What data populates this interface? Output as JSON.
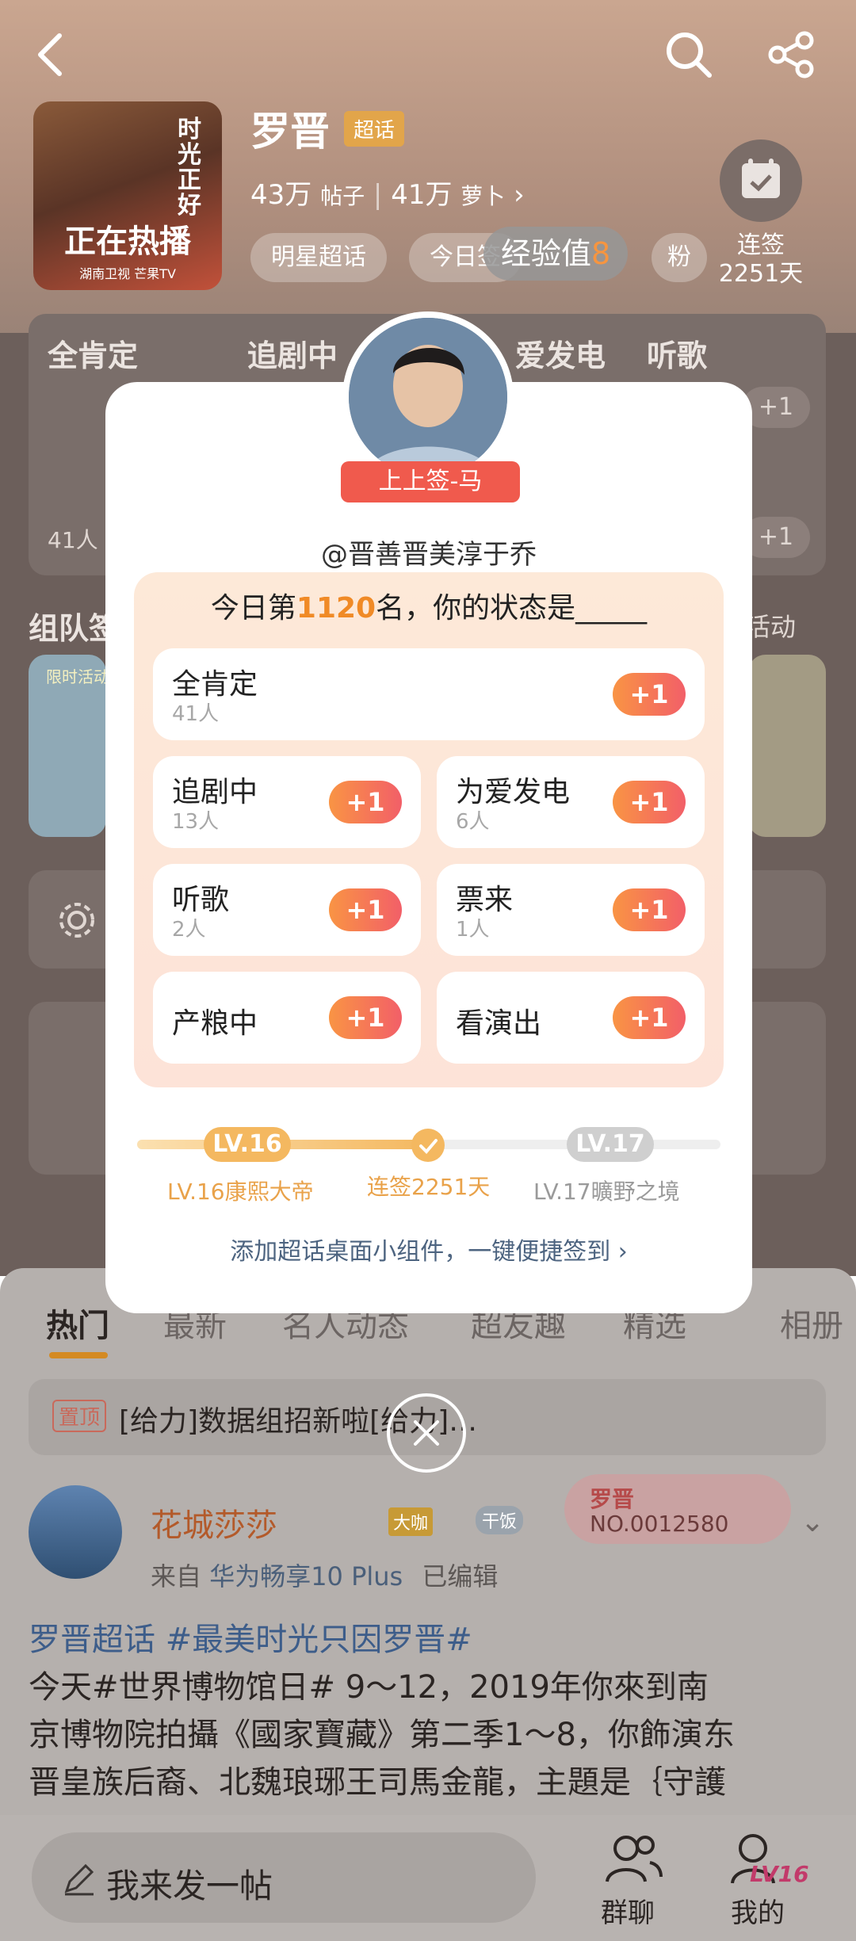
{
  "header": {
    "title": "罗晋",
    "badge": "超话",
    "posts_count": "43万",
    "posts_label": "帖子",
    "fans_count": "41万",
    "fans_label": "萝卜",
    "tag_star": "明星超话",
    "tag_today": "今日签",
    "tag_fans": "粉",
    "exp_toast": "经验值",
    "exp_toast_num": "8",
    "sign_label": "连签",
    "sign_days": "2251天",
    "cover_main": "正在热播",
    "cover_side": "时光正好",
    "cover_sub": "湖南卫视 芒果TV"
  },
  "background": {
    "cat_1": "全肯定",
    "cat_2": "追剧中",
    "cat_3": "爱发电",
    "cat_4": "听歌",
    "plus": "+1",
    "people": "41人",
    "team_label": "组队签",
    "activity_label": "活动",
    "limited": "限时活动"
  },
  "dialog": {
    "ribbon": "上上签-马",
    "username": "@晋善晋美淳于乔",
    "rank_prefix": "今日第",
    "rank_number": "1120",
    "rank_suffix": "名，你的状态是_____",
    "options": [
      {
        "name": "全肯定",
        "count": "41人",
        "plus": "+1"
      },
      {
        "name": "追剧中",
        "count": "13人",
        "plus": "+1"
      },
      {
        "name": "为爱发电",
        "count": "6人",
        "plus": "+1"
      },
      {
        "name": "听歌",
        "count": "2人",
        "plus": "+1"
      },
      {
        "name": "票来",
        "count": "1人",
        "plus": "+1"
      },
      {
        "name": "产粮中",
        "count": "",
        "plus": "+1"
      },
      {
        "name": "看演出",
        "count": "",
        "plus": "+1"
      }
    ],
    "level_current_pill": "LV.16",
    "level_next_pill": "LV.17",
    "level_current_name": "LV.16康熙大帝",
    "level_middle": "连签2251天",
    "level_next_name": "LV.17曠野之境",
    "progress": 0.5,
    "widget_link": "添加超话桌面小组件，一键便捷签到"
  },
  "feed": {
    "tabs": [
      "热门",
      "最新",
      "名人动态",
      "超友趣",
      "精选",
      "相册"
    ],
    "pinned_badge": "置顶",
    "pinned_text": "[给力]数据组招新啦[给力]…",
    "author": "花城莎莎",
    "author_tag": "大咖",
    "author_tag2": "干饭",
    "source_prefix": "来自",
    "source_device": "华为畅享10 Plus",
    "edited": "已编辑",
    "fan_badge_name": "罗晋",
    "fan_badge_no": "NO.0012580",
    "post_line1": "罗晋超话 #最美时光只因罗晋#",
    "post_line2": "今天#世界博物馆日# 9～12，2019年你來到南",
    "post_line3": "京博物院拍攝《國家寶藏》第二季1～8，你飾演东",
    "post_line4": "晋皇族后裔、北魏琅琊王司馬金龍，主題是｛守護"
  },
  "bottom": {
    "compose": "我来发一帖",
    "group_chat": "群聊",
    "mine": "我的",
    "mine_level": "LV16"
  },
  "colors": {
    "accent_orange": "#f7953f",
    "plus_gradient_end": "#f25f68",
    "ribbon_red": "#f05a4d",
    "level_gold": "#f4b860"
  }
}
